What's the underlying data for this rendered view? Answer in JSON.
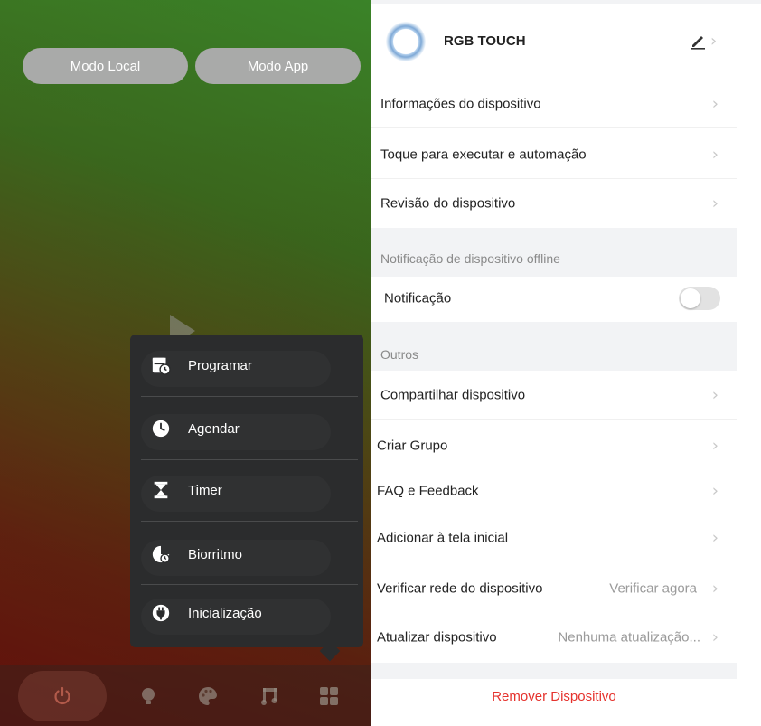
{
  "left_panel": {
    "mode_buttons": {
      "local": "Modo Local",
      "app": "Modo App"
    },
    "popup_menu": [
      {
        "label": "Programar",
        "icon": "schedule-calendar-icon"
      },
      {
        "label": "Agendar",
        "icon": "clock-icon"
      },
      {
        "label": "Timer",
        "icon": "hourglass-icon"
      },
      {
        "label": "Biorritmo",
        "icon": "biorhythm-icon"
      },
      {
        "label": "Inicialização",
        "icon": "power-plug-icon"
      }
    ],
    "bottom_bar": [
      "power-icon",
      "bulb-icon",
      "palette-icon",
      "music-icon",
      "grid-icon"
    ]
  },
  "device": {
    "name": "RGB TOUCH"
  },
  "settings": {
    "rows": [
      "Informações  do dispositivo",
      "Toque para executar e automação",
      "Revisão do dispositivo"
    ],
    "offline_section": "Notificação de dispositivo offline",
    "notification_label": "Notificação",
    "notification_enabled": false,
    "others_section": "Outros",
    "others_rows": {
      "share": "Compartilhar dispositivo",
      "group": "Criar Grupo",
      "faq": "FAQ e Feedback",
      "home": "Adicionar à tela inicial",
      "network": "Verificar rede do dispositivo",
      "network_value": "Verificar agora",
      "update": "Atualizar dispositivo",
      "update_value": "Nenhuma atualização..."
    },
    "remove": "Remover Dispositivo"
  },
  "colors": {
    "remove": "#e5322d",
    "popup_bg": "#2b2c2d",
    "mode_button": "#a9aaa9"
  }
}
